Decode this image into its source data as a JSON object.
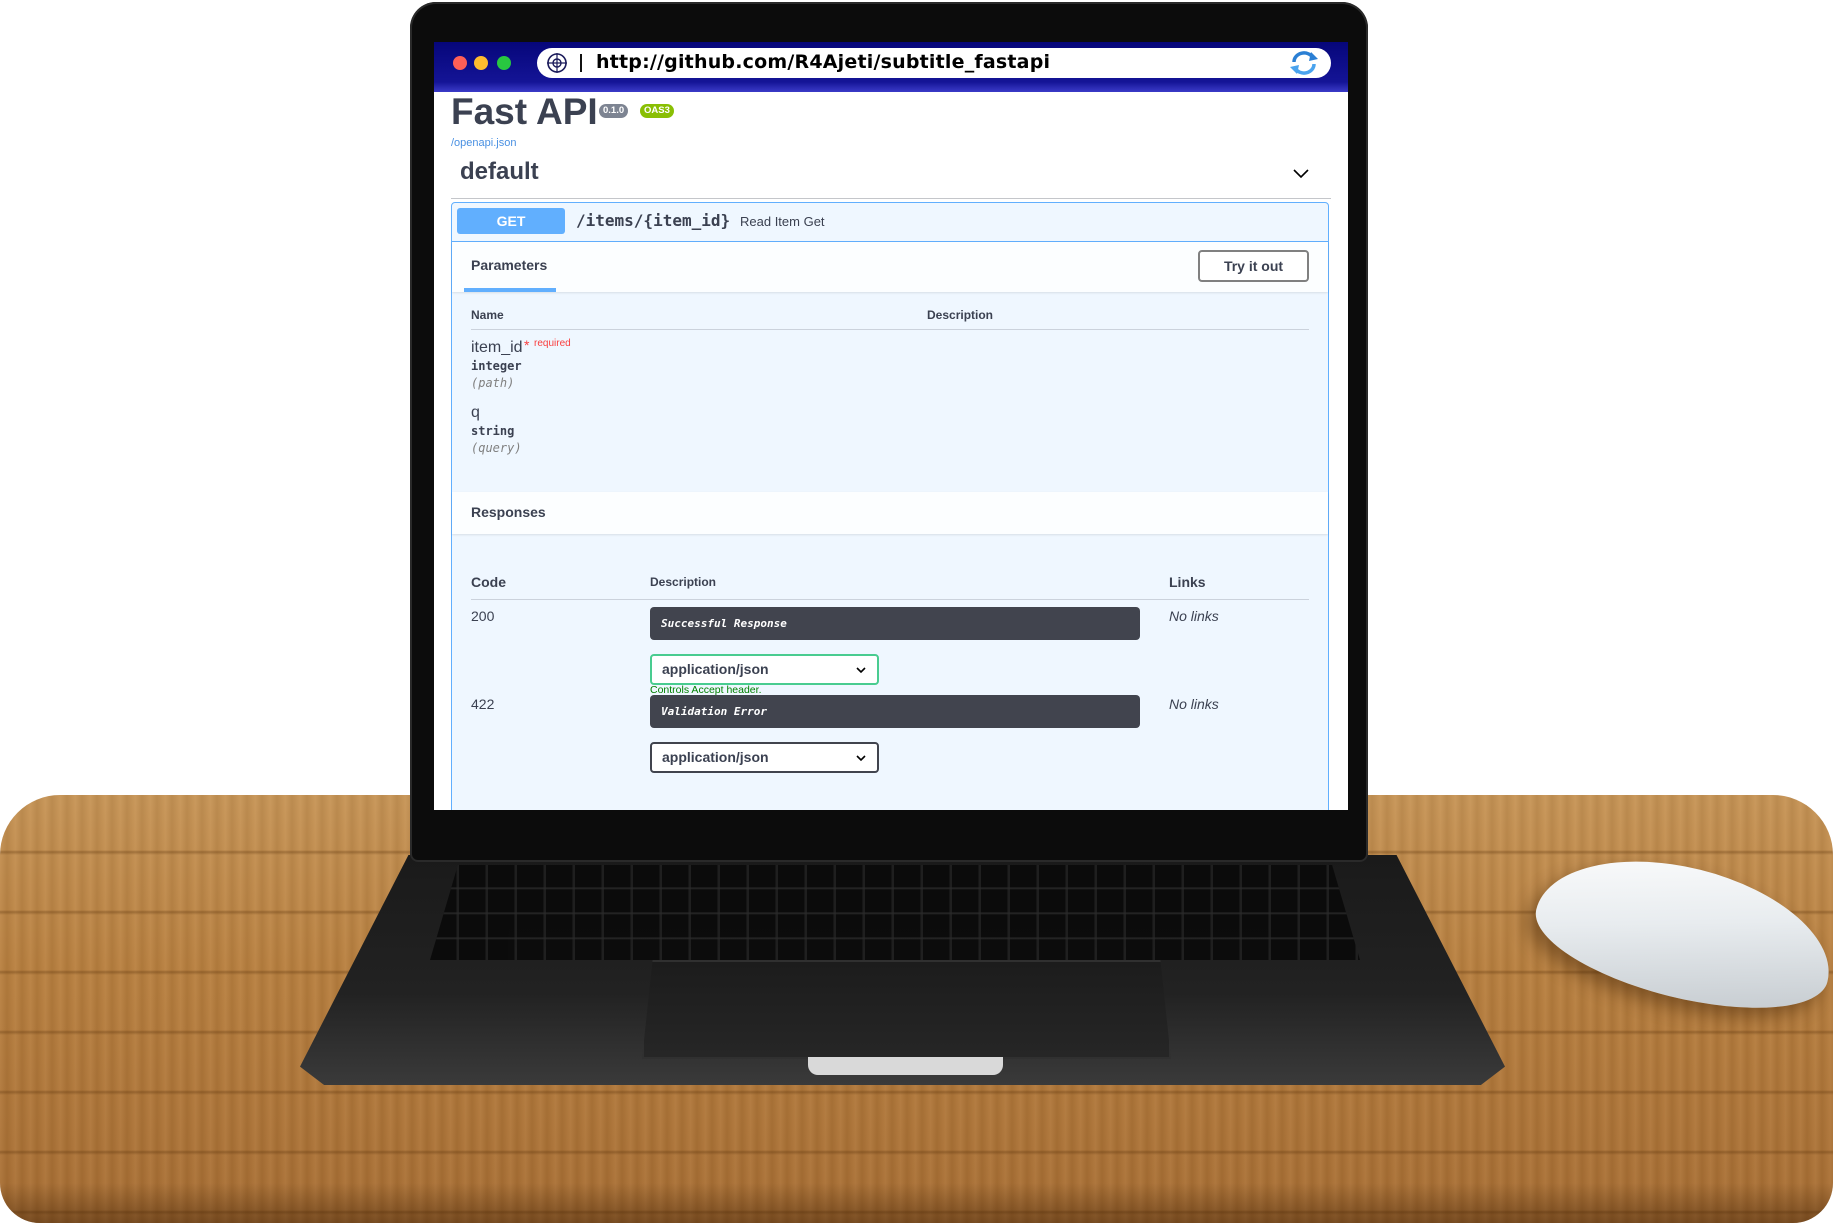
{
  "browser": {
    "url": "http://github.com/R4Ajeti/subtitle_fastapi"
  },
  "app": {
    "title": "Fast API",
    "version": "0.1.0",
    "oas": "OAS3",
    "spec_link": "/openapi.json"
  },
  "tag": {
    "name": "default"
  },
  "operation": {
    "method": "GET",
    "path": "/items/{item_id}",
    "summary": "Read Item Get",
    "tab_label": "Parameters",
    "try_label": "Try it out",
    "param_headers": {
      "name": "Name",
      "description": "Description"
    },
    "parameters": [
      {
        "name": "item_id",
        "required_mark": "*",
        "required_text": "required",
        "type": "integer",
        "in": "(path)"
      },
      {
        "name": "q",
        "type": "string",
        "in": "(query)"
      }
    ],
    "responses_title": "Responses",
    "response_headers": {
      "code": "Code",
      "description": "Description",
      "links": "Links"
    },
    "responses": [
      {
        "code": "200",
        "description": "Successful Response",
        "links": "No links",
        "media_type": "application/json",
        "hint": "Controls Accept header."
      },
      {
        "code": "422",
        "description": "Validation Error",
        "links": "No links",
        "media_type": "application/json"
      }
    ]
  },
  "colors": {
    "get_accent": "#61affe",
    "browser_bar": "#06067a",
    "text": "#3b4151"
  }
}
